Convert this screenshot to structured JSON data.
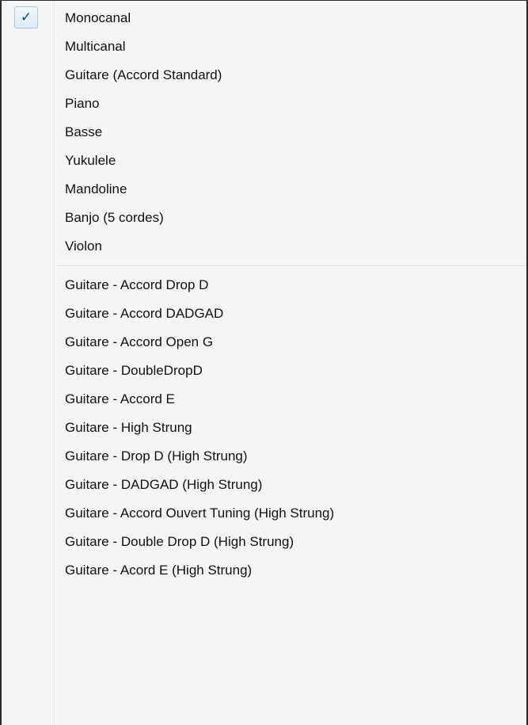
{
  "menu": {
    "checkmark_glyph": "✓",
    "group1": [
      {
        "label": "Monocanal",
        "checked": true
      },
      {
        "label": "Multicanal",
        "checked": false
      },
      {
        "label": "Guitare (Accord Standard)",
        "checked": false
      },
      {
        "label": "Piano",
        "checked": false
      },
      {
        "label": "Basse",
        "checked": false
      },
      {
        "label": "Yukulele",
        "checked": false
      },
      {
        "label": "Mandoline",
        "checked": false
      },
      {
        "label": "Banjo (5 cordes)",
        "checked": false
      },
      {
        "label": "Violon",
        "checked": false
      }
    ],
    "group2": [
      {
        "label": "Guitare - Accord Drop D"
      },
      {
        "label": "Guitare - Accord DADGAD"
      },
      {
        "label": "Guitare - Accord Open G"
      },
      {
        "label": "Guitare - DoubleDropD"
      },
      {
        "label": "Guitare - Accord E"
      },
      {
        "label": "Guitare - High Strung"
      },
      {
        "label": "Guitare - Drop D (High Strung)"
      },
      {
        "label": "Guitare - DADGAD (High Strung)"
      },
      {
        "label": "Guitare - Accord Ouvert Tuning (High Strung)"
      },
      {
        "label": "Guitare - Double Drop D (High Strung)"
      },
      {
        "label": "Guitare - Acord E (High Strung)"
      }
    ]
  },
  "colors": {
    "menu_background": "#f5f5f5",
    "border": "#2a2a2a",
    "check_color": "#0f3aa3",
    "check_highlight": "#dcebfb"
  }
}
